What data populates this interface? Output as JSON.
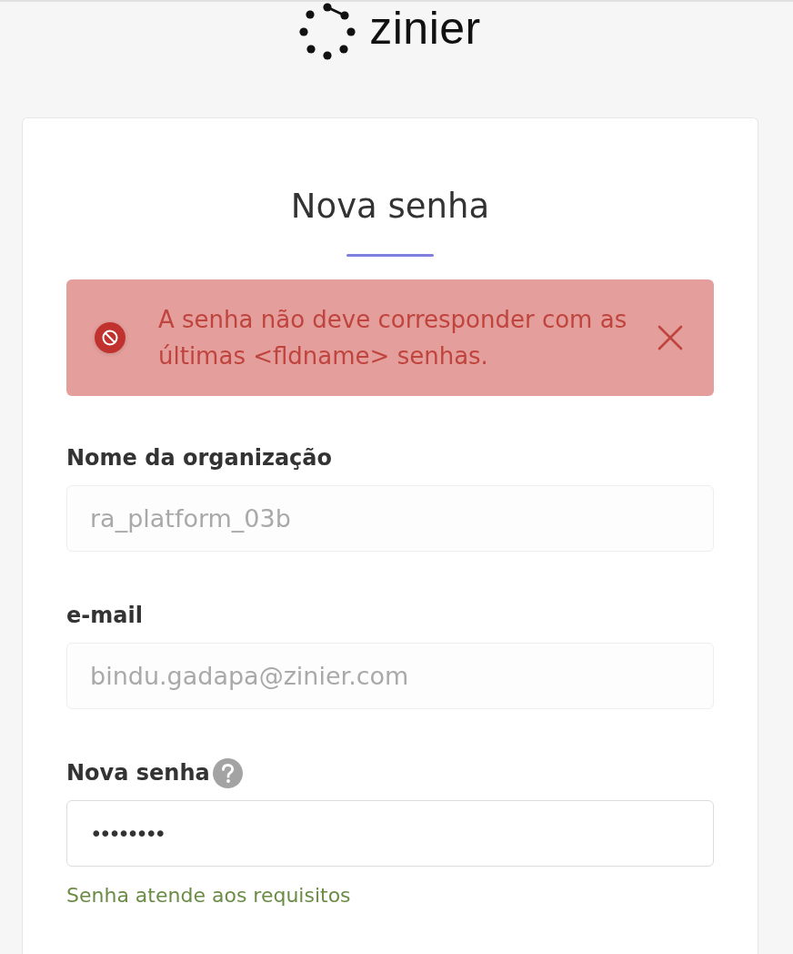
{
  "logo": {
    "text": "zinier"
  },
  "title": "Nova senha",
  "alert": {
    "kind": "error",
    "message": "A senha não deve corresponder com as últimas <fldname> senhas.",
    "dismissible": true
  },
  "fields": [
    {
      "kind": "text",
      "label": "Nome da organização",
      "value": "ra_platform_03b",
      "disabled": true
    },
    {
      "kind": "text",
      "label": "e-mail",
      "value": "bindu.gadapa@zinier.com",
      "disabled": true
    },
    {
      "kind": "password",
      "label": "Nova senha",
      "value": "••••••••",
      "disabled": false,
      "help": true,
      "hint": {
        "kind": "success",
        "text": "Senha atende aos requisitos"
      }
    }
  ]
}
